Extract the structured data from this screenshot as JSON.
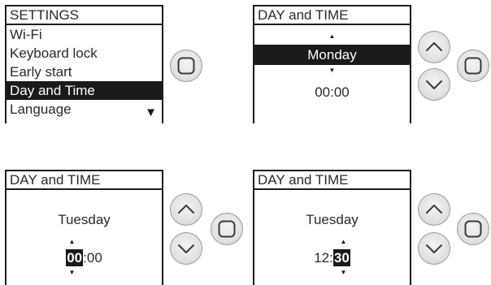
{
  "settings_screen": {
    "title": "SETTINGS",
    "items": [
      {
        "label": "Wi-Fi"
      },
      {
        "label": "Keyboard lock"
      },
      {
        "label": "Early start"
      },
      {
        "label": "Day and Time"
      },
      {
        "label": "Language"
      }
    ],
    "selected_index": 3,
    "scroll_arrow": "▼"
  },
  "day_time_day_screen": {
    "title": "DAY and TIME",
    "day": "Monday",
    "time": "00:00"
  },
  "day_time_hour_screen": {
    "title": "DAY and TIME",
    "day": "Tuesday",
    "time_hour": "00",
    "time_separator": ":",
    "time_minute": "00"
  },
  "day_time_minute_screen": {
    "title": "DAY and TIME",
    "day": "Tuesday",
    "time_hour": "12",
    "time_separator": ":",
    "time_minute": "30"
  },
  "icons": {
    "up": "chevron-up-icon",
    "down": "chevron-down-icon",
    "ok": "rounded-square-icon"
  },
  "colors": {
    "highlight_bg": "#1a1a1a",
    "highlight_fg": "#ffffff",
    "button_face": "#e2e2e2"
  }
}
